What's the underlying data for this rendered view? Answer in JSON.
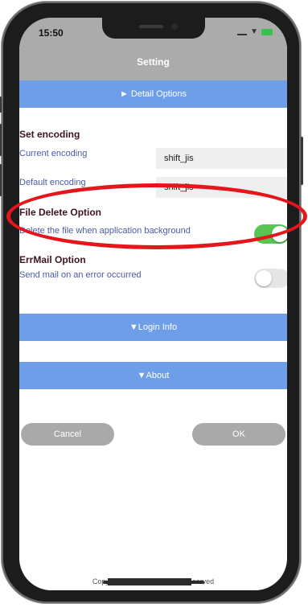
{
  "status_bar": {
    "time": "15:50"
  },
  "nav": {
    "title": "Setting"
  },
  "sections": {
    "detail_options": "► Detail Options",
    "login_info": "▼Login Info",
    "about": "▼About"
  },
  "encoding": {
    "heading": "Set encoding",
    "current_label": "Current encoding",
    "current_value": "shift_jis",
    "default_label": "Default encoding",
    "default_value": "shift_jis"
  },
  "file_delete": {
    "heading": "File Delete Option",
    "label": "Delete the file when application background",
    "enabled": true
  },
  "errmail": {
    "heading": "ErrMail Option",
    "label": "Send mail on an error occurred",
    "enabled": false
  },
  "buttons": {
    "cancel": "Cancel",
    "ok": "OK"
  },
  "footer": {
    "copyright": "Copyright 2020 © All Rights Reserved"
  },
  "colors": {
    "section_bar": "#6f9ee8",
    "toggle_on": "#58c453",
    "annotation": "#e4161b"
  },
  "icons": [
    "cellular-signal-icon",
    "wifi-icon",
    "battery-icon"
  ]
}
